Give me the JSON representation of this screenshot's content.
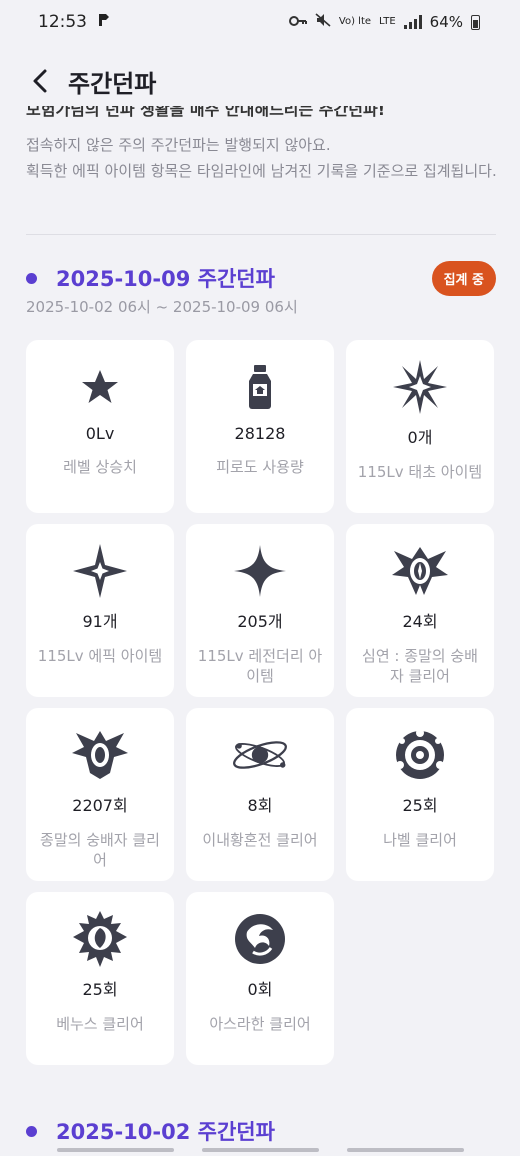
{
  "status": {
    "time": "12:53",
    "network": "LTE",
    "network_sub": "Vo) lte",
    "battery": "64%"
  },
  "header": {
    "title": "주간던파"
  },
  "intro_cut": "모험가님의 던파 생활을 매주 안내해드리는 주간던파!",
  "notice": "접속하지 않은 주의 주간던파는 발행되지 않아요.\n획득한 에픽 아이템 항목은 타임라인에 남겨진 기록을 기준으로 집계됩니다.",
  "week": {
    "title": "2025-10-09 주간던파",
    "badge": "집계 중",
    "range": "2025-10-02 06시 ~ 2025-10-09 06시"
  },
  "stats": [
    {
      "icon": "star-icon",
      "value": "0Lv",
      "label": "레벨 상승치"
    },
    {
      "icon": "potion-bottle-icon",
      "value": "28128",
      "label": "피로도 사용량"
    },
    {
      "icon": "burst-star-icon",
      "value": "0개",
      "label": "115Lv 태초 아이템"
    },
    {
      "icon": "sparkle-star-icon",
      "value": "91개",
      "label": "115Lv 에픽 아이템"
    },
    {
      "icon": "four-point-star-icon",
      "value": "205개",
      "label": "115Lv 레전더리 아이템"
    },
    {
      "icon": "abyss-emblem-icon",
      "value": "24회",
      "label": "심연 : 종말의 숭배자 클리어"
    },
    {
      "icon": "cult-emblem-icon",
      "value": "2207회",
      "label": "종말의 숭배자 클리어"
    },
    {
      "icon": "orbit-planet-icon",
      "value": "8회",
      "label": "이내황혼전 클리어"
    },
    {
      "icon": "nabel-emblem-icon",
      "value": "25회",
      "label": "나벨 클리어"
    },
    {
      "icon": "venus-emblem-icon",
      "value": "25회",
      "label": "베누스 클리어"
    },
    {
      "icon": "asrahan-emblem-icon",
      "value": "0회",
      "label": "아스라한 클리어"
    }
  ],
  "next_week": {
    "title": "2025-10-02 주간던파"
  },
  "colors": {
    "accent": "#5b3fd1",
    "badge": "#d9531f",
    "icon": "#3d3f4c",
    "background": "#f2f2f6"
  }
}
